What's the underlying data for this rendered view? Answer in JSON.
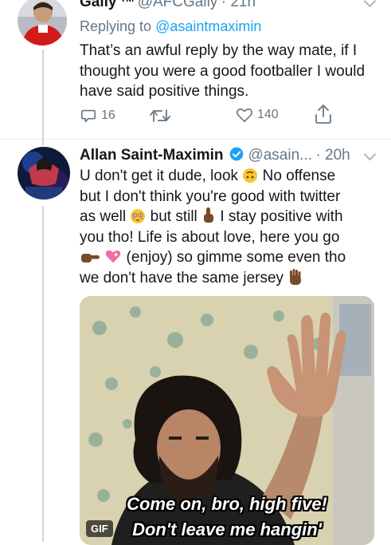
{
  "tweet1": {
    "name": "Gally",
    "name_suffix": "TM",
    "handle": "@AFCGally",
    "time": "· 21h",
    "replying_label": "Replying to",
    "replying_handle": "@asaintmaximin",
    "text": "That’s an awful reply by the way mate, if I thought you were a good footballer I would have said positive things.",
    "reply_count": "16",
    "like_count": "140"
  },
  "tweet2": {
    "name": "Allan Saint-Maximin",
    "handle": "@asain...",
    "time": "· 20h",
    "line1_a": "U don't get it dude, look ",
    "line1_b": " No offense",
    "line2": "but I don't think you're good with twitter",
    "line3_a": "as well ",
    "line3_b": " but still ",
    "line3_c": " I stay positive with",
    "line4": "you tho! Life is about love, here you go",
    "line5_b": " (enjoy) so gimme some even tho",
    "line6_a": "we don't have the same jersey ",
    "gif_caption_1": "Come on, bro, high five!",
    "gif_caption_2": "Don't leave me hangin'",
    "gif_badge": "GIF"
  },
  "colors": {
    "accent": "#1da1f2",
    "secondary_text": "#657786",
    "verified": "#1da1f2",
    "thread_line": "#ccd6dd"
  }
}
